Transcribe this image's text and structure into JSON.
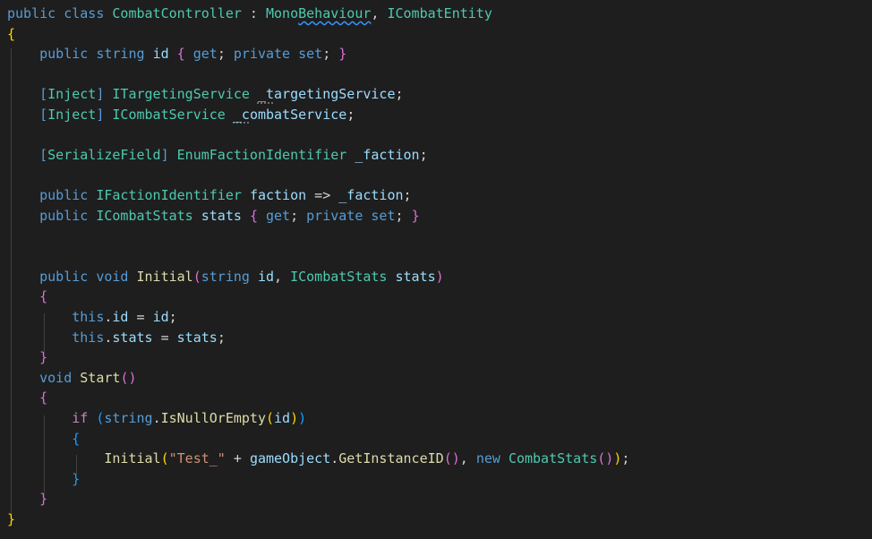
{
  "colors": {
    "background": "#1e1e1e",
    "keyword": "#569cd6",
    "type": "#4ec9b0",
    "variable": "#9cdcfe",
    "method": "#dcdcaa",
    "control": "#c586c0",
    "string": "#ce9178",
    "plain": "#d4d4d4",
    "bracket1": "#ffd700",
    "bracket2": "#da70d6",
    "bracket3": "#179fff",
    "guide": "#404040"
  },
  "code": {
    "lines": [
      {
        "tokens": [
          {
            "t": "public",
            "c": "keyword"
          },
          {
            "t": " "
          },
          {
            "t": "class",
            "c": "keyword"
          },
          {
            "t": " "
          },
          {
            "t": "CombatController",
            "c": "type"
          },
          {
            "t": " : "
          },
          {
            "t": "Mono",
            "c": "type"
          },
          {
            "t": "Behaviour",
            "c": "type",
            "u": "squiggle"
          },
          {
            "t": ", "
          },
          {
            "t": "ICombatEntity",
            "c": "type"
          }
        ]
      },
      {
        "tokens": [
          {
            "t": "{",
            "c": "bracket1"
          }
        ]
      },
      {
        "tokens": [
          {
            "t": "    "
          },
          {
            "t": "public",
            "c": "keyword"
          },
          {
            "t": " "
          },
          {
            "t": "string",
            "c": "keyword"
          },
          {
            "t": " "
          },
          {
            "t": "id",
            "c": "variable"
          },
          {
            "t": " "
          },
          {
            "t": "{",
            "c": "bracket2"
          },
          {
            "t": " "
          },
          {
            "t": "get",
            "c": "keyword"
          },
          {
            "t": "; "
          },
          {
            "t": "private",
            "c": "keyword"
          },
          {
            "t": " "
          },
          {
            "t": "set",
            "c": "keyword"
          },
          {
            "t": "; "
          },
          {
            "t": "}",
            "c": "bracket2"
          }
        ]
      },
      {
        "tokens": []
      },
      {
        "tokens": [
          {
            "t": "    "
          },
          {
            "t": "[",
            "c": "keyword"
          },
          {
            "t": "Inject",
            "c": "type"
          },
          {
            "t": "]",
            "c": "keyword"
          },
          {
            "t": " "
          },
          {
            "t": "ITargetingService",
            "c": "type"
          },
          {
            "t": " "
          },
          {
            "t": "_t",
            "c": "variable",
            "u": "dots"
          },
          {
            "t": "argetingService",
            "c": "variable"
          },
          {
            "t": ";"
          }
        ]
      },
      {
        "tokens": [
          {
            "t": "    "
          },
          {
            "t": "[",
            "c": "keyword"
          },
          {
            "t": "Inject",
            "c": "type"
          },
          {
            "t": "]",
            "c": "keyword"
          },
          {
            "t": " "
          },
          {
            "t": "ICombatService",
            "c": "type"
          },
          {
            "t": " "
          },
          {
            "t": "_c",
            "c": "variable",
            "u": "dots"
          },
          {
            "t": "ombatService",
            "c": "variable"
          },
          {
            "t": ";"
          }
        ]
      },
      {
        "tokens": []
      },
      {
        "tokens": [
          {
            "t": "    "
          },
          {
            "t": "[",
            "c": "keyword"
          },
          {
            "t": "SerializeField",
            "c": "type"
          },
          {
            "t": "]",
            "c": "keyword"
          },
          {
            "t": " "
          },
          {
            "t": "EnumFactionIdentifier",
            "c": "type"
          },
          {
            "t": " "
          },
          {
            "t": "_faction",
            "c": "variable"
          },
          {
            "t": ";"
          }
        ]
      },
      {
        "tokens": []
      },
      {
        "tokens": [
          {
            "t": "    "
          },
          {
            "t": "public",
            "c": "keyword"
          },
          {
            "t": " "
          },
          {
            "t": "IFactionIdentifier",
            "c": "type"
          },
          {
            "t": " "
          },
          {
            "t": "faction",
            "c": "variable"
          },
          {
            "t": " => "
          },
          {
            "t": "_faction",
            "c": "variable"
          },
          {
            "t": ";"
          }
        ]
      },
      {
        "tokens": [
          {
            "t": "    "
          },
          {
            "t": "public",
            "c": "keyword"
          },
          {
            "t": " "
          },
          {
            "t": "ICombatStats",
            "c": "type"
          },
          {
            "t": " "
          },
          {
            "t": "stats",
            "c": "variable"
          },
          {
            "t": " "
          },
          {
            "t": "{",
            "c": "bracket2"
          },
          {
            "t": " "
          },
          {
            "t": "get",
            "c": "keyword"
          },
          {
            "t": "; "
          },
          {
            "t": "private",
            "c": "keyword"
          },
          {
            "t": " "
          },
          {
            "t": "set",
            "c": "keyword"
          },
          {
            "t": "; "
          },
          {
            "t": "}",
            "c": "bracket2"
          }
        ]
      },
      {
        "tokens": []
      },
      {
        "tokens": []
      },
      {
        "tokens": [
          {
            "t": "    "
          },
          {
            "t": "public",
            "c": "keyword"
          },
          {
            "t": " "
          },
          {
            "t": "void",
            "c": "keyword"
          },
          {
            "t": " "
          },
          {
            "t": "Initial",
            "c": "method"
          },
          {
            "t": "(",
            "c": "bracket2"
          },
          {
            "t": "string",
            "c": "keyword"
          },
          {
            "t": " "
          },
          {
            "t": "id",
            "c": "variable"
          },
          {
            "t": ", "
          },
          {
            "t": "ICombatStats",
            "c": "type"
          },
          {
            "t": " "
          },
          {
            "t": "stats",
            "c": "variable"
          },
          {
            "t": ")",
            "c": "bracket2"
          }
        ]
      },
      {
        "tokens": [
          {
            "t": "    "
          },
          {
            "t": "{",
            "c": "bracket2"
          }
        ]
      },
      {
        "tokens": [
          {
            "t": "        "
          },
          {
            "t": "this",
            "c": "keyword"
          },
          {
            "t": "."
          },
          {
            "t": "id",
            "c": "variable"
          },
          {
            "t": " = "
          },
          {
            "t": "id",
            "c": "variable"
          },
          {
            "t": ";"
          }
        ]
      },
      {
        "tokens": [
          {
            "t": "        "
          },
          {
            "t": "this",
            "c": "keyword"
          },
          {
            "t": "."
          },
          {
            "t": "stats",
            "c": "variable"
          },
          {
            "t": " = "
          },
          {
            "t": "stats",
            "c": "variable"
          },
          {
            "t": ";"
          }
        ]
      },
      {
        "tokens": [
          {
            "t": "    "
          },
          {
            "t": "}",
            "c": "bracket2"
          }
        ]
      },
      {
        "tokens": [
          {
            "t": "    "
          },
          {
            "t": "void",
            "c": "keyword"
          },
          {
            "t": " "
          },
          {
            "t": "Start",
            "c": "method"
          },
          {
            "t": "()",
            "c": "bracket2"
          }
        ]
      },
      {
        "tokens": [
          {
            "t": "    "
          },
          {
            "t": "{",
            "c": "bracket2"
          }
        ]
      },
      {
        "tokens": [
          {
            "t": "        "
          },
          {
            "t": "if",
            "c": "control"
          },
          {
            "t": " "
          },
          {
            "t": "(",
            "c": "bracket3"
          },
          {
            "t": "string",
            "c": "keyword"
          },
          {
            "t": "."
          },
          {
            "t": "IsNullOrEmpty",
            "c": "method"
          },
          {
            "t": "(",
            "c": "bracket1"
          },
          {
            "t": "id",
            "c": "variable"
          },
          {
            "t": ")",
            "c": "bracket1"
          },
          {
            "t": ")",
            "c": "bracket3"
          }
        ]
      },
      {
        "tokens": [
          {
            "t": "        "
          },
          {
            "t": "{",
            "c": "bracket3"
          }
        ]
      },
      {
        "tokens": [
          {
            "t": "            "
          },
          {
            "t": "Initial",
            "c": "method"
          },
          {
            "t": "(",
            "c": "bracket1"
          },
          {
            "t": "\"Test_\"",
            "c": "string"
          },
          {
            "t": " + "
          },
          {
            "t": "gameObject",
            "c": "variable"
          },
          {
            "t": "."
          },
          {
            "t": "GetInstanceID",
            "c": "method"
          },
          {
            "t": "()",
            "c": "bracket2"
          },
          {
            "t": ", "
          },
          {
            "t": "new",
            "c": "keyword"
          },
          {
            "t": " "
          },
          {
            "t": "CombatStats",
            "c": "type"
          },
          {
            "t": "()",
            "c": "bracket2"
          },
          {
            "t": ")",
            "c": "bracket1"
          },
          {
            "t": ";"
          }
        ]
      },
      {
        "tokens": [
          {
            "t": "        "
          },
          {
            "t": "}",
            "c": "bracket3"
          }
        ]
      },
      {
        "tokens": [
          {
            "t": "    "
          },
          {
            "t": "}",
            "c": "bracket2"
          }
        ]
      },
      {
        "tokens": [
          {
            "t": "}",
            "c": "bracket1"
          }
        ]
      }
    ]
  }
}
